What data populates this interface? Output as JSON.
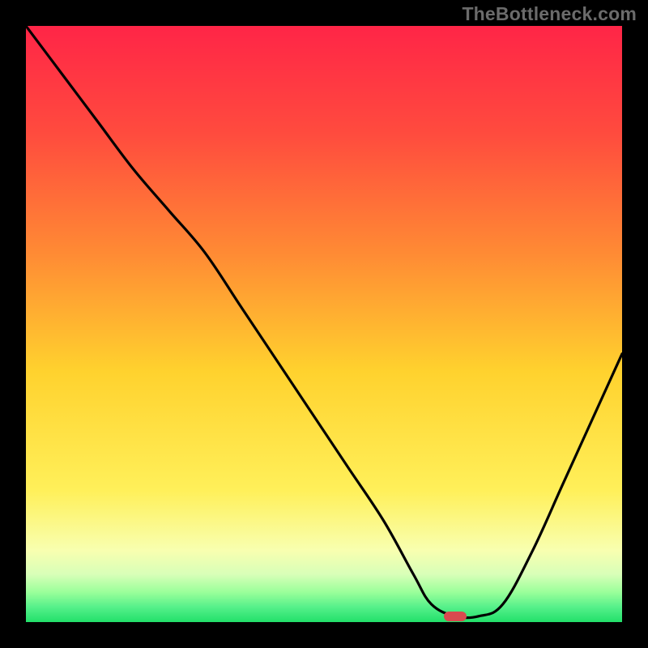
{
  "watermark": "TheBottleneck.com",
  "colors": {
    "frame": "#000000",
    "gradient_top": "#ff2547",
    "gradient_upper_mid": "#ff7a34",
    "gradient_mid": "#ffd22e",
    "gradient_lower_mid": "#fff05a",
    "gradient_green_light": "#9aff6e",
    "gradient_green": "#22e06a",
    "curve": "#000000",
    "marker": "#d84a4f"
  },
  "chart_data": {
    "type": "line",
    "title": "",
    "xlabel": "",
    "ylabel": "",
    "xlim": [
      0,
      100
    ],
    "ylim": [
      0,
      100
    ],
    "series": [
      {
        "name": "bottleneck-curve",
        "x": [
          0,
          6,
          12,
          18,
          24,
          30,
          36,
          42,
          48,
          54,
          60,
          65,
          68,
          72,
          76,
          80,
          85,
          90,
          95,
          100
        ],
        "y": [
          100,
          92,
          84,
          76,
          69,
          62,
          53,
          44,
          35,
          26,
          17,
          8,
          3,
          1,
          1,
          3,
          12,
          23,
          34,
          45
        ]
      }
    ],
    "marker": {
      "x_center": 72,
      "y": 1,
      "width_pct": 4
    },
    "annotations": []
  }
}
